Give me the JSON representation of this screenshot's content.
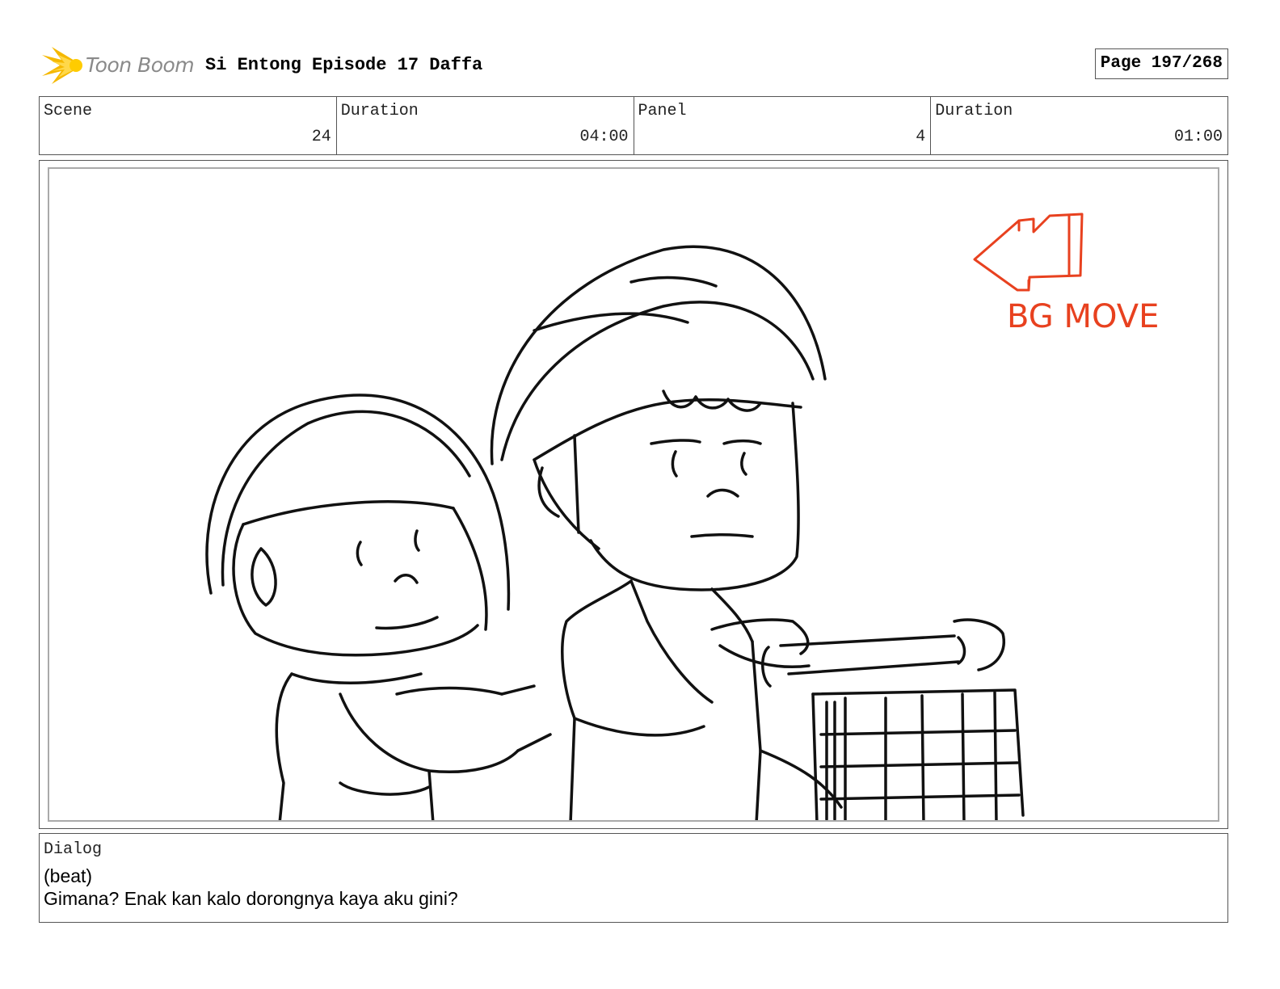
{
  "header": {
    "logo_text": "Toon Boom",
    "title": "Si Entong Episode 17 Daffa",
    "page": "Page 197/268"
  },
  "info": {
    "scene_label": "Scene",
    "scene_value": "24",
    "scene_duration_label": "Duration",
    "scene_duration_value": "04:00",
    "panel_label": "Panel",
    "panel_value": "4",
    "panel_duration_label": "Duration",
    "panel_duration_value": "01:00"
  },
  "panel": {
    "annotation": "BG MOVE",
    "annotation_color": "#e8411f"
  },
  "dialog": {
    "label": "Dialog",
    "lines": [
      "(beat)",
      "Gimana? Enak kan kalo dorongnya kaya aku gini?"
    ]
  }
}
